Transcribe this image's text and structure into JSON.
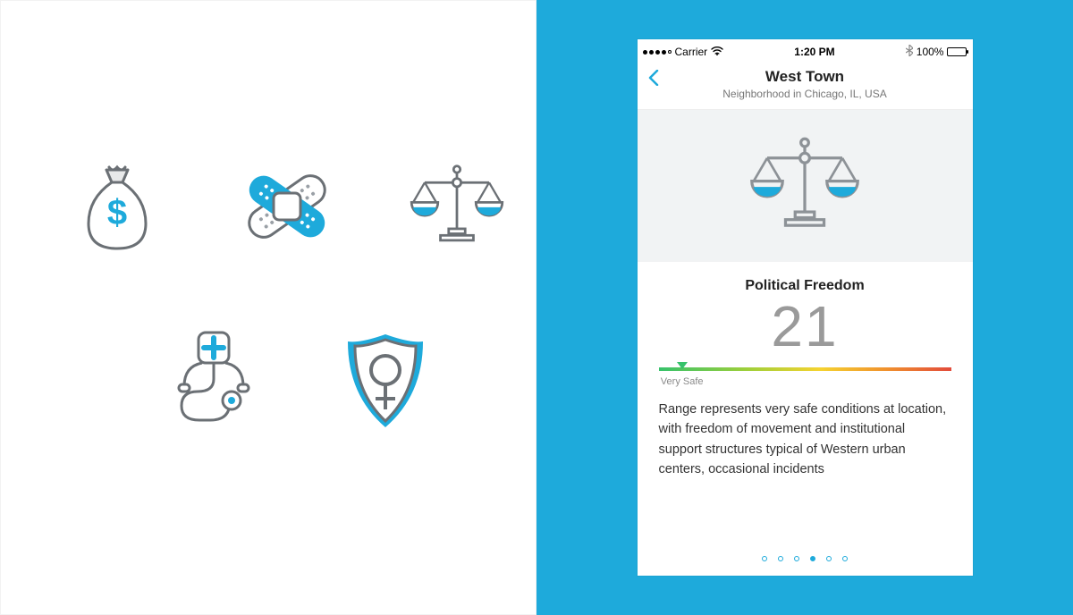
{
  "palette_icons": [
    "money-bag-icon",
    "bandage-icon",
    "scales-icon",
    "stethoscope-icon",
    "shield-female-icon"
  ],
  "colors": {
    "accent": "#1eaadb",
    "icon_stroke": "#6b7075",
    "gauge_safe": "#36c26b"
  },
  "statusbar": {
    "carrier": "Carrier",
    "time": "1:20 PM",
    "battery_pct": "100%"
  },
  "header": {
    "title": "West Town",
    "subtitle": "Neighborhood in Chicago, IL, USA"
  },
  "metric": {
    "title": "Political Freedom",
    "value": "21",
    "gauge_position_pct": 8,
    "gauge_label": "Very Safe",
    "description": "Range represents very safe conditions at location, with freedom of movement and institutional support structures typical of Western urban centers, occasional incidents"
  },
  "pager": {
    "count": 6,
    "active_index": 3
  }
}
